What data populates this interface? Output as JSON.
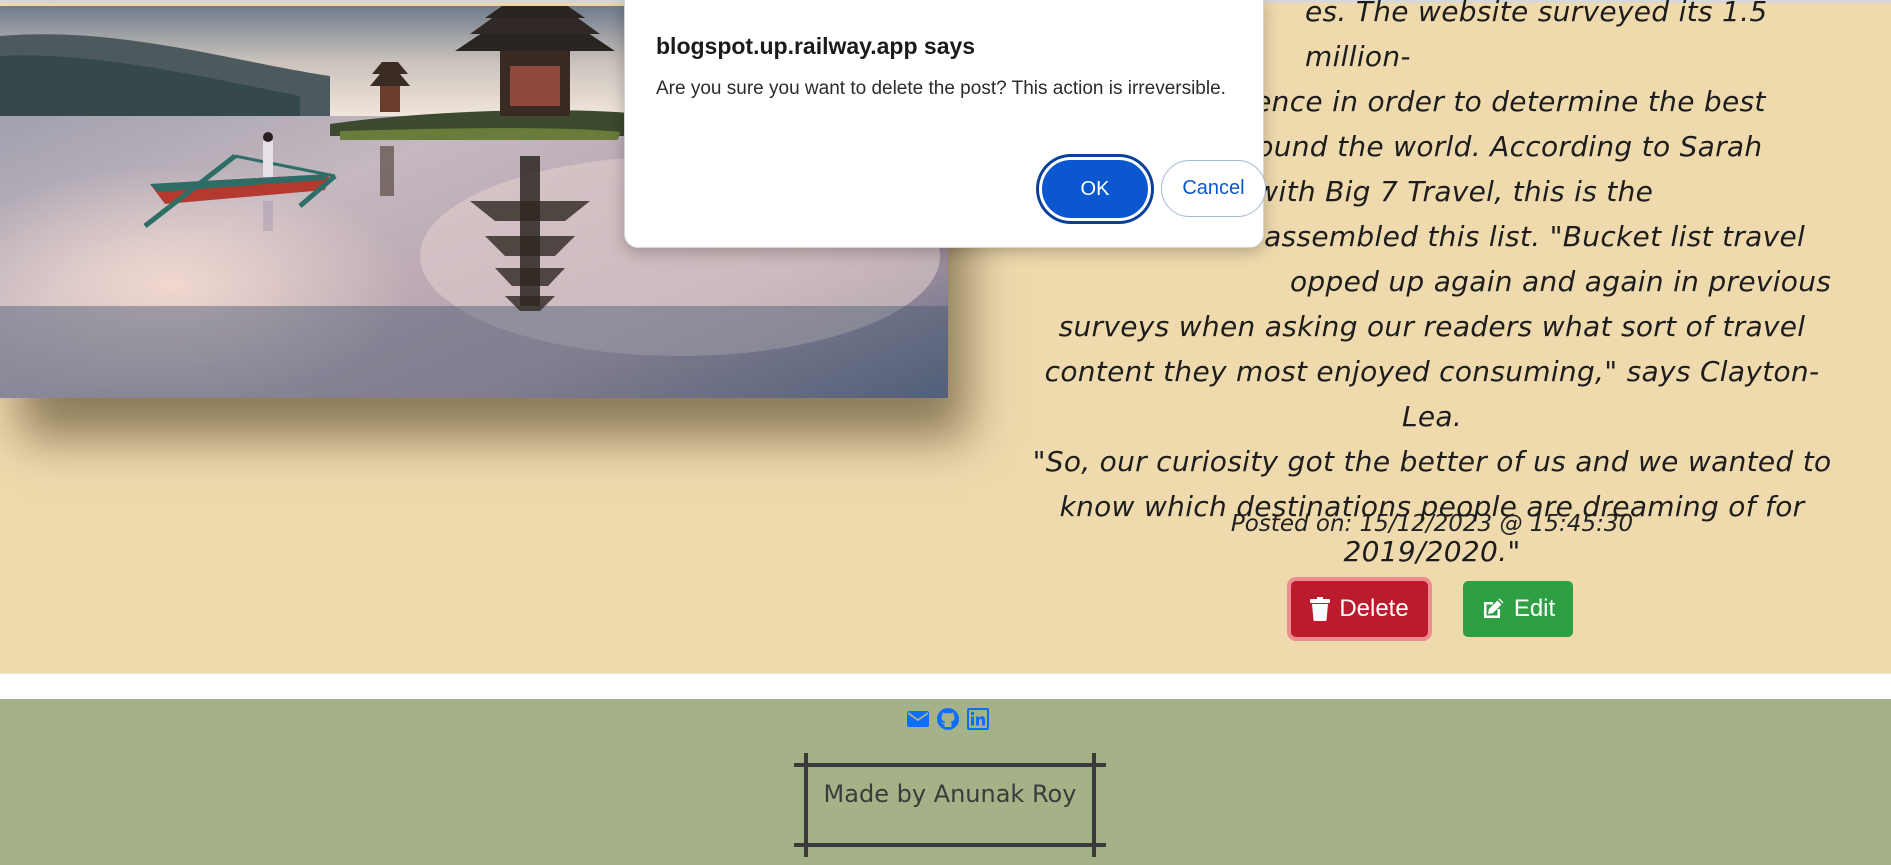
{
  "dialog": {
    "title": "blogspot.up.railway.app says",
    "message": "Are you sure you want to delete the post? This action is irreversible.",
    "ok_label": "OK",
    "cancel_label": "Cancel",
    "accent_color": "#0b57d0"
  },
  "post": {
    "body_lines": [
      "es. The website surveyed its 1.5 million-",
      "dience in order to determine the best",
      "around the world. According to Sarah",
      "of content with Big 7 Travel, this is the",
      "s assembled this list. \"Bucket list travel",
      "opped up again and again in previous",
      "surveys when asking our readers what sort of travel",
      "content they most enjoyed consuming,\" says Clayton-Lea.",
      "\"So, our curiosity got the better of us and we wanted to",
      "know which destinations people are dreaming of for",
      "2019/2020.\""
    ],
    "posted_on": "Posted on: 15/12/2023 @ 15:45:30",
    "image_icon": "lake-temple-photo",
    "background_color": "#efdaae"
  },
  "actions": {
    "delete_label": "Delete",
    "delete_icon": "trash-icon",
    "delete_color": "#bb1b2c",
    "edit_label": "Edit",
    "edit_icon": "pencil-square-icon",
    "edit_color": "#2ea043"
  },
  "footer": {
    "social": [
      "envelope-icon",
      "github-icon",
      "linkedin-icon"
    ],
    "credit": "Made by Anunak Roy",
    "background_color": "#a5b288"
  }
}
